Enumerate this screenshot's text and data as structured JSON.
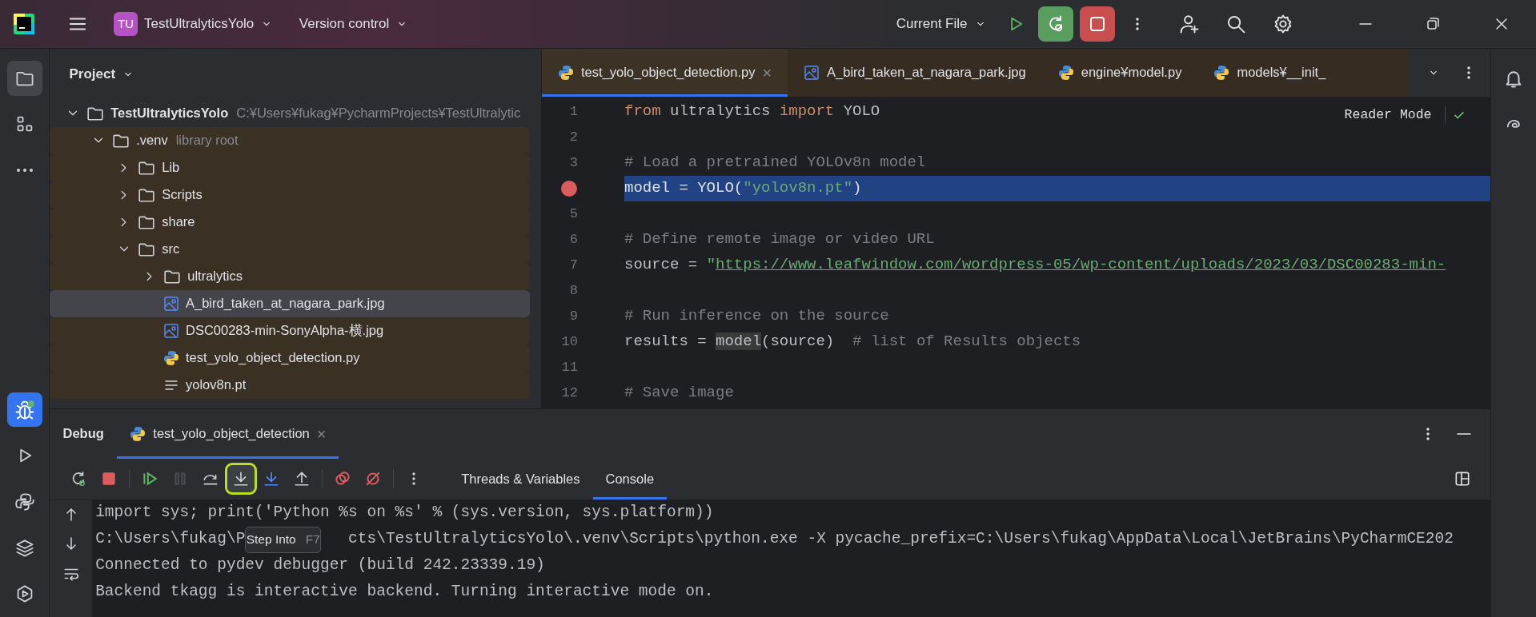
{
  "title_bar": {
    "project_badge": "TU",
    "project": "TestUltralyticsYolo",
    "vcs": "Version control",
    "run_config": "Current File"
  },
  "tool_stripe_top": [
    {
      "kind": "folder",
      "selected": true
    },
    {
      "kind": "structure",
      "selected": false
    },
    {
      "kind": "more",
      "selected": false
    }
  ],
  "tool_stripe_bottom": [
    {
      "kind": "debug",
      "selected": true
    },
    {
      "kind": "run",
      "selected": false
    },
    {
      "kind": "python",
      "selected": false
    },
    {
      "kind": "layers",
      "selected": false
    },
    {
      "kind": "services",
      "selected": false
    }
  ],
  "project": {
    "title": "Project",
    "tree": [
      {
        "name": "TestUltralyticsYolo",
        "hint": "C:¥Users¥fukag¥PycharmProjects¥TestUltralytic",
        "kind": "folder",
        "expanded": true,
        "selected": false,
        "children": [
          {
            "name": ".venv",
            "hint": "library root",
            "kind": "folder",
            "expanded": true,
            "selected": false,
            "children": [
              {
                "name": "Lib",
                "kind": "folder",
                "expanded": false,
                "selected": false
              },
              {
                "name": "Scripts",
                "kind": "folder",
                "expanded": false,
                "selected": false
              },
              {
                "name": "share",
                "kind": "folder",
                "expanded": false,
                "selected": false
              },
              {
                "name": "src",
                "kind": "folder",
                "expanded": true,
                "selected": false,
                "children": [
                  {
                    "name": "ultralytics",
                    "kind": "folder",
                    "expanded": false,
                    "selected": false
                  },
                  {
                    "name": "A_bird_taken_at_nagara_park.jpg",
                    "kind": "image",
                    "selected": true
                  },
                  {
                    "name": "DSC00283-min-SonyAlpha-横.jpg",
                    "kind": "image",
                    "selected": false
                  },
                  {
                    "name": "test_yolo_object_detection.py",
                    "kind": "python",
                    "selected": false
                  },
                  {
                    "name": "yolov8n.pt",
                    "kind": "text",
                    "selected": false
                  }
                ]
              }
            ]
          }
        ]
      }
    ]
  },
  "editor": {
    "tabs": [
      {
        "label": "test_yolo_object_detection.py",
        "kind": "python",
        "selected": true,
        "close": "×"
      },
      {
        "label": "A_bird_taken_at_nagara_park.jpg",
        "kind": "image",
        "selected": false
      },
      {
        "label": "engine¥model.py",
        "kind": "python",
        "selected": false
      },
      {
        "label": "models¥__init_",
        "kind": "python",
        "selected": false
      }
    ],
    "reader_mode": "Reader Mode",
    "lines": [
      {
        "number": "1",
        "breakpoint": false,
        "current": false,
        "tokens": [
          {
            "kind": "keyword",
            "text": "from"
          },
          {
            "kind": "plain",
            "text": " ultralytics "
          },
          {
            "kind": "keyword",
            "text": "import"
          },
          {
            "kind": "plain",
            "text": " YOLO"
          }
        ]
      },
      {
        "number": "2",
        "breakpoint": false,
        "current": false
      },
      {
        "number": "3",
        "breakpoint": false,
        "current": false,
        "tokens": [
          {
            "kind": "comment",
            "text": "# Load a pretrained YOLOv8n model"
          }
        ]
      },
      {
        "breakpoint": true,
        "current": true,
        "tokens": [
          {
            "kind": "plain",
            "text": "model = YOLO("
          },
          {
            "kind": "string",
            "text": "\"yolov8n.pt\""
          },
          {
            "kind": "plain",
            "text": ")"
          }
        ]
      },
      {
        "number": "5",
        "breakpoint": false,
        "current": false
      },
      {
        "number": "6",
        "breakpoint": false,
        "current": false,
        "tokens": [
          {
            "kind": "comment",
            "text": "# Define remote image or video URL"
          }
        ]
      },
      {
        "number": "7",
        "breakpoint": false,
        "current": false,
        "tokens": [
          {
            "kind": "plain",
            "text": "source = "
          },
          {
            "kind": "string",
            "text": "\""
          },
          {
            "kind": "url",
            "text": "https://www.leafwindow.com/wordpress-05/wp-content/uploads/2023/03/DSC00283-min-"
          }
        ]
      },
      {
        "number": "8",
        "breakpoint": false,
        "current": false
      },
      {
        "number": "9",
        "breakpoint": false,
        "current": false,
        "tokens": [
          {
            "kind": "comment",
            "text": "# Run inference on the source"
          }
        ]
      },
      {
        "number": "10",
        "breakpoint": false,
        "current": false,
        "tokens": [
          {
            "kind": "plain",
            "text": "results = "
          },
          {
            "kind": "usage",
            "text": "model"
          },
          {
            "kind": "plain",
            "text": "(source)  "
          },
          {
            "kind": "comment",
            "text": "# list of Results objects"
          }
        ]
      },
      {
        "number": "11",
        "breakpoint": false,
        "current": false
      },
      {
        "number": "12",
        "breakpoint": false,
        "current": false,
        "tokens": [
          {
            "kind": "comment",
            "text": "# Save image"
          }
        ]
      }
    ]
  },
  "debug": {
    "title": "Debug",
    "tabs": [
      {
        "label": "test_yolo_object_detection",
        "selected": true,
        "close": "×"
      }
    ],
    "toolbar": [
      {
        "kind": "rerun",
        "disabled": false,
        "focused": false
      },
      {
        "kind": "stop",
        "disabled": false,
        "focused": false
      },
      {
        "kind": "resume",
        "disabled": false,
        "focused": false
      },
      {
        "kind": "pause",
        "disabled": true,
        "focused": false
      },
      {
        "kind": "step-over",
        "disabled": false,
        "focused": false
      },
      {
        "kind": "step-into",
        "disabled": false,
        "focused": true
      },
      {
        "kind": "step-into-my-code",
        "disabled": false,
        "focused": false
      },
      {
        "kind": "step-out",
        "disabled": false,
        "focused": false
      },
      {
        "kind": "breakpoints",
        "disabled": false,
        "focused": false
      },
      {
        "kind": "mute",
        "disabled": false,
        "focused": false
      },
      {
        "kind": "more",
        "disabled": false,
        "focused": false
      }
    ],
    "views": [
      {
        "label": "Threads & Variables",
        "selected": false
      },
      {
        "label": "Console",
        "selected": true
      }
    ],
    "tooltip": {
      "label": "Step Into",
      "shortcut": "F7"
    },
    "console": [
      {
        "parts": [
          "import sys; print('Python %s on %s' % (sys.version, sys.platform))"
        ]
      },
      {
        "parts": [
          "C:\\Users\\fukag\\P",
          "cts\\TestUltralyticsYolo\\.venv\\Scripts\\python.exe -X pycache_prefix=C:\\Users\\fukag\\AppData\\Local\\JetBrains\\PyCharmCE202"
        ]
      },
      {
        "parts": [
          "Connected to pydev debugger (build 242.23339.19)"
        ]
      },
      {
        "parts": [
          "Backend tkagg is interactive backend. Turning interactive mode on."
        ]
      }
    ]
  }
}
